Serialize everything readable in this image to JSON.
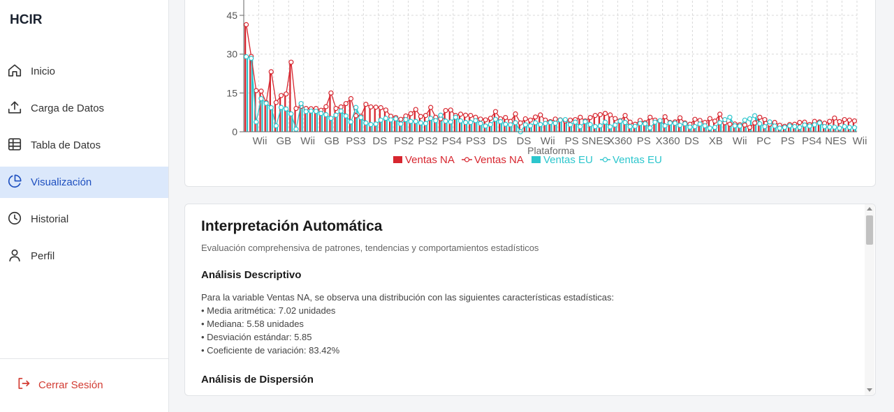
{
  "app": {
    "title": "HCIR"
  },
  "sidebar": {
    "items": [
      {
        "label": "Inicio",
        "icon": "home-icon"
      },
      {
        "label": "Carga de Datos",
        "icon": "upload-icon"
      },
      {
        "label": "Tabla de Datos",
        "icon": "table-icon"
      },
      {
        "label": "Visualización",
        "icon": "pie-chart-icon",
        "active": true
      },
      {
        "label": "Historial",
        "icon": "clock-icon"
      },
      {
        "label": "Perfil",
        "icon": "user-icon"
      }
    ],
    "logout_label": "Cerrar Sesión"
  },
  "colors": {
    "na": "#d7262f",
    "eu": "#2cc6cd",
    "active_bg": "#dbe8fb",
    "active_text": "#1d4fbf",
    "logout": "#d23b32"
  },
  "chart_data": {
    "type": "bar",
    "xlabel": "Plataforma",
    "y_ticks": [
      0,
      15,
      30,
      45
    ],
    "ylim": [
      0,
      45
    ],
    "grid": true,
    "legend_position": "bottom",
    "x_tick_labels": [
      "Wii",
      "GB",
      "Wii",
      "GB",
      "PS3",
      "DS",
      "PS2",
      "PS2",
      "PS4",
      "PS3",
      "DS",
      "DS",
      "Wii",
      "PS",
      "SNES",
      "X360",
      "PS",
      "X360",
      "DS",
      "XB",
      "Wii",
      "PC",
      "PS",
      "PS4",
      "NES",
      "Wii"
    ],
    "legend": [
      "Ventas NA",
      "Ventas NA",
      "Ventas EU",
      "Ventas EU"
    ],
    "series": [
      {
        "name": "Ventas NA",
        "kind": "bar+line",
        "values": [
          41.4,
          29.1,
          15.9,
          15.7,
          11.3,
          23.2,
          11.3,
          14.0,
          14.6,
          26.9,
          9.0,
          9.8,
          9.0,
          8.9,
          9.0,
          8.3,
          9.7,
          15.0,
          9.0,
          9.6,
          10.9,
          12.8,
          6.2,
          6.0,
          10.6,
          9.6,
          9.5,
          9.3,
          8.4,
          6.0,
          5.5,
          4.8,
          6.1,
          7.0,
          8.6,
          5.9,
          6.3,
          9.4,
          5.6,
          5.0,
          8.2,
          8.4,
          6.3,
          6.8,
          6.4,
          6.3,
          5.6,
          4.9,
          4.6,
          5.2,
          7.8,
          5.0,
          5.5,
          4.0,
          6.9,
          3.4,
          5.0,
          4.5,
          5.7,
          6.5,
          4.5,
          3.9,
          4.9,
          4.6,
          4.2,
          4.5,
          4.7,
          5.6,
          4.2,
          5.5,
          6.3,
          6.6,
          7.1,
          6.5,
          5.1,
          4.3,
          6.3,
          3.7,
          2.9,
          4.4,
          3.5,
          5.6,
          4.5,
          4.2,
          5.8,
          3.6,
          3.8,
          5.4,
          3.4,
          2.9,
          4.8,
          4.4,
          3.6,
          5.1,
          4.1,
          6.8,
          3.5,
          2.9,
          3.0,
          2.7,
          2.6,
          1.7,
          3.4,
          5.6,
          4.7,
          2.9,
          3.6,
          2.5,
          2.1,
          2.8,
          2.9,
          3.6,
          3.7,
          2.8,
          4.0,
          3.8,
          3.3,
          4.0,
          5.3,
          3.9,
          4.7,
          4.5,
          4.2
        ],
        "color": "#d7262f"
      },
      {
        "name": "Ventas EU",
        "kind": "bar+line",
        "values": [
          29.0,
          28.4,
          3.8,
          12.8,
          11.0,
          9.3,
          2.3,
          9.4,
          8.8,
          6.9,
          1.0,
          10.9,
          7.8,
          8.0,
          7.9,
          7.1,
          6.6,
          5.2,
          6.4,
          8.0,
          6.1,
          3.8,
          9.4,
          5.5,
          3.4,
          2.8,
          3.0,
          4.5,
          5.2,
          4.6,
          5.0,
          3.0,
          4.7,
          4.0,
          4.0,
          3.4,
          3.2,
          5.2,
          4.3,
          6.4,
          4.1,
          3.8,
          5.6,
          4.2,
          3.6,
          3.6,
          4.3,
          3.2,
          2.2,
          2.8,
          4.8,
          3.9,
          2.9,
          2.7,
          3.5,
          0.0,
          2.7,
          2.3,
          3.5,
          2.8,
          3.2,
          3.6,
          3.3,
          4.5,
          4.7,
          2.7,
          3.7,
          2.0,
          3.9,
          2.8,
          2.0,
          2.3,
          3.7,
          1.9,
          2.6,
          4.1,
          3.6,
          2.0,
          2.1,
          3.2,
          3.1,
          1.5,
          3.7,
          4.3,
          2.3,
          3.4,
          3.3,
          2.5,
          3.1,
          1.8,
          2.0,
          3.0,
          2.3,
          1.4,
          1.7,
          3.5,
          4.7,
          5.6,
          2.3,
          2.2,
          4.5,
          5.0,
          6.2,
          3.1,
          2.0,
          3.8,
          2.2,
          1.4,
          1.7,
          2.3,
          2.0,
          1.7,
          2.6,
          2.2,
          2.7,
          3.4,
          2.0,
          1.8,
          1.8,
          1.4,
          2.0,
          1.7,
          1.6
        ],
        "color": "#2cc6cd"
      }
    ]
  },
  "interpretation": {
    "title": "Interpretación Automática",
    "subtitle": "Evaluación comprehensiva de patrones, tendencias y comportamientos estadísticos",
    "descriptive": {
      "title": "Análisis Descriptivo",
      "intro": "Para la variable Ventas NA, se observa una distribución con las siguientes características estadísticas:",
      "bullets": [
        "• Media aritmética: 7.02 unidades",
        "• Mediana: 5.58 unidades",
        "• Desviación estándar: 5.85",
        "• Coeficiente de variación: 83.42%"
      ]
    },
    "dispersion_title": "Análisis de Dispersión"
  }
}
